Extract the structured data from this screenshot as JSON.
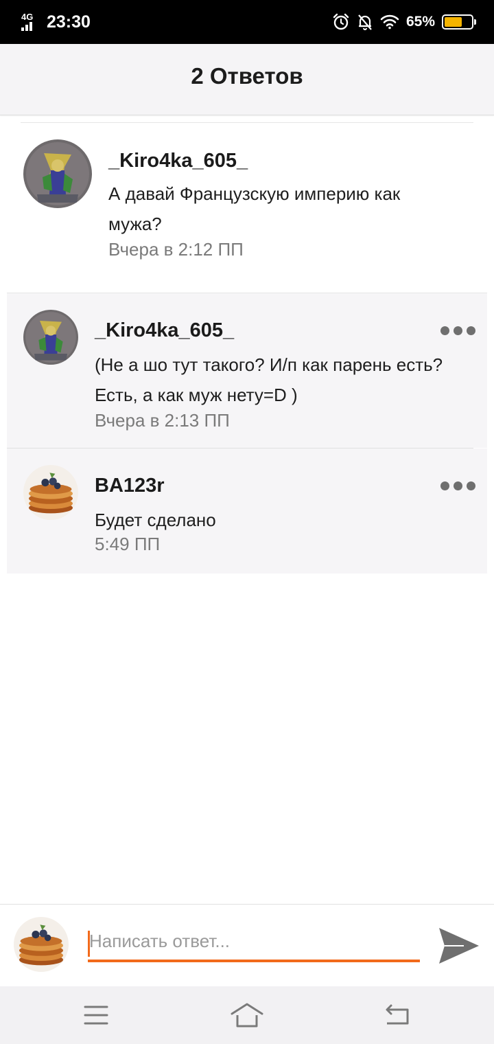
{
  "status_bar": {
    "network": "4G",
    "time": "23:30",
    "battery_percent": "65%",
    "battery_level": 0.65,
    "icons": [
      "alarm-icon",
      "bell-off-icon",
      "wifi-icon",
      "battery-icon"
    ]
  },
  "header": {
    "title": "2 Ответов"
  },
  "main_comment": {
    "author": "_Kiro4ka_605_",
    "text": "А давай Французскую империю как мужа?",
    "time": "Вчера в 2:12 ПП"
  },
  "replies": [
    {
      "author": "_Kiro4ka_605_",
      "text": "(Не а шо тут такого? И/п как парень есть? Есть, а как муж нету=D )",
      "time": "Вчера в 2:13 ПП"
    },
    {
      "author": "BA123r",
      "text": "Будет сделано",
      "time": "5:49 ПП"
    }
  ],
  "composer": {
    "placeholder": "Написать ответ..."
  },
  "colors": {
    "accent": "#f26a1b",
    "reply_bg": "#f6f5f7",
    "header_bg": "#f5f4f6",
    "meta_text": "#7a7a7a",
    "battery_fill": "#f5b400"
  }
}
